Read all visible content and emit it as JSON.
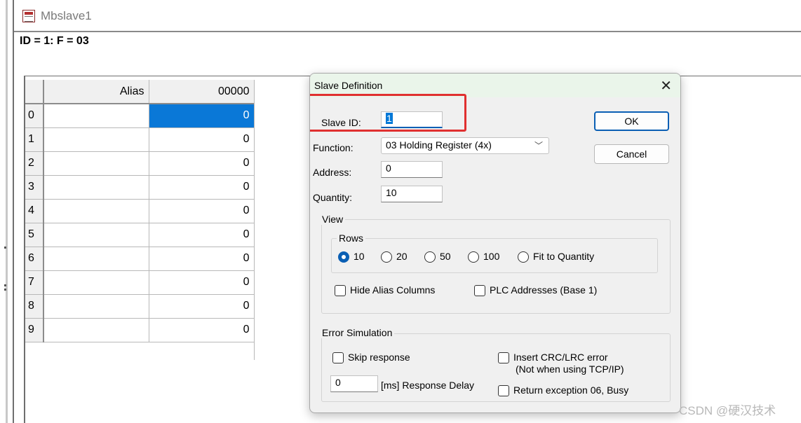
{
  "window": {
    "title": "Mbslave1"
  },
  "header": {
    "text": "ID = 1: F = 03"
  },
  "grid": {
    "columns": [
      "Alias",
      "00000"
    ],
    "rows": [
      {
        "num": "0",
        "alias": "",
        "value": "0"
      },
      {
        "num": "1",
        "alias": "",
        "value": "0"
      },
      {
        "num": "2",
        "alias": "",
        "value": "0"
      },
      {
        "num": "3",
        "alias": "",
        "value": "0"
      },
      {
        "num": "4",
        "alias": "",
        "value": "0"
      },
      {
        "num": "5",
        "alias": "",
        "value": "0"
      },
      {
        "num": "6",
        "alias": "",
        "value": "0"
      },
      {
        "num": "7",
        "alias": "",
        "value": "0"
      },
      {
        "num": "8",
        "alias": "",
        "value": "0"
      },
      {
        "num": "9",
        "alias": "",
        "value": "0"
      }
    ]
  },
  "dialog": {
    "title": "Slave Definition",
    "close": "✕",
    "slave_id_label": "Slave ID:",
    "slave_id_value": "1",
    "function_label": "Function:",
    "function_value": "03 Holding Register (4x)",
    "address_label": "Address:",
    "address_value": "0",
    "quantity_label": "Quantity:",
    "quantity_value": "10",
    "ok": "OK",
    "cancel": "Cancel",
    "view": {
      "label": "View",
      "rows_label": "Rows",
      "rows_options": [
        "10",
        "20",
        "50",
        "100",
        "Fit to Quantity"
      ],
      "rows_selected": "10",
      "hide_alias": "Hide Alias Columns",
      "plc_addresses": "PLC Addresses (Base 1)"
    },
    "error_sim": {
      "label": "Error Simulation",
      "skip_response": "Skip response",
      "insert_crc_line1": "Insert CRC/LRC error",
      "insert_crc_line2": "(Not when using TCP/IP)",
      "delay_value": "0",
      "delay_label": "[ms] Response Delay",
      "return_exception": "Return exception 06, Busy"
    }
  },
  "watermark": "CSDN @硬汉技术",
  "colors": {
    "selection": "#0a78d7",
    "highlight_box": "#e03030",
    "dialog_title_bg": "#eaf5ea"
  }
}
